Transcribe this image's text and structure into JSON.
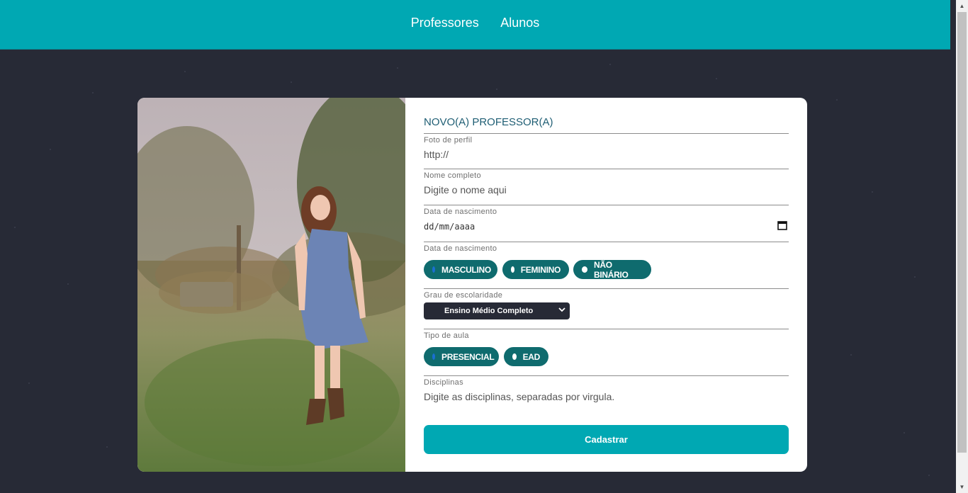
{
  "nav": {
    "items": [
      {
        "label": "Professores"
      },
      {
        "label": "Alunos"
      }
    ]
  },
  "form": {
    "title": "NOVO(A) PROFESSOR(A)",
    "photo_label": "Foto de perfil",
    "photo_value": "http://",
    "name_label": "Nome completo",
    "name_placeholder": "Digite o nome aqui",
    "birth_label": "Data de nascimento",
    "birth_placeholder": "dd/mm/aaaa",
    "gender_label": "Data de nascimento",
    "gender_options": [
      {
        "label": "MASCULINO",
        "checked": true
      },
      {
        "label": "FEMININO",
        "checked": false
      },
      {
        "label": "NÃO BINÁRIO",
        "checked": false
      }
    ],
    "education_label": "Grau de escolaridade",
    "education_selected": "Ensino Médio Completo",
    "class_type_label": "Tipo de aula",
    "class_type_options": [
      {
        "label": "PRESENCIAL",
        "checked": true
      },
      {
        "label": "EAD",
        "checked": false
      }
    ],
    "subjects_label": "Disciplinas",
    "subjects_placeholder": "Digite as disciplinas, separadas por virgula.",
    "submit_label": "Cadastrar"
  },
  "colors": {
    "header": "#00a8b3",
    "background": "#272a36",
    "pill": "#0f6b6e",
    "button": "#00a8b3",
    "title": "#1f5e74"
  },
  "icons": {
    "date_picker": "calendar-icon",
    "select": "chevron-down-icon"
  }
}
